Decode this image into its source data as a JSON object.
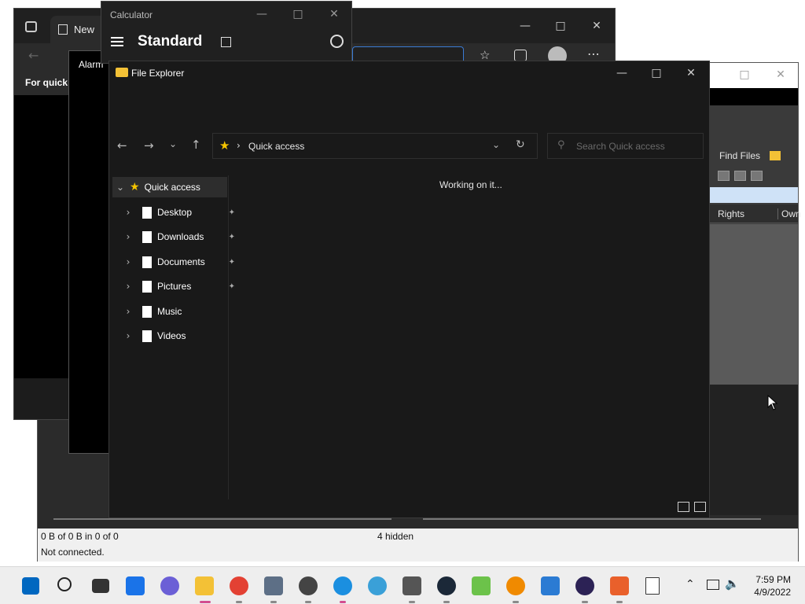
{
  "filezilla": {
    "find_files": "Find Files",
    "col_rights": "Rights",
    "col_owner": "Own",
    "status_left": "0 B of 0 B in 0 of 0",
    "status_hidden": "4 hidden",
    "status_conn": "Not connected."
  },
  "edge": {
    "tab_title": "New",
    "info_text": "For quick a"
  },
  "alarms": {
    "title": "Alarm"
  },
  "calculator": {
    "title": "Calculator",
    "mode": "Standard"
  },
  "explorer": {
    "title": "File Explorer",
    "address": "Quick access",
    "search_placeholder": "Search Quick access",
    "working": "Working on it...",
    "sidebar": [
      {
        "label": "Quick access"
      },
      {
        "label": "Desktop",
        "pinned": true
      },
      {
        "label": "Downloads",
        "pinned": true
      },
      {
        "label": "Documents",
        "pinned": true
      },
      {
        "label": "Pictures",
        "pinned": true
      },
      {
        "label": "Music",
        "pinned": false
      },
      {
        "label": "Videos",
        "pinned": false
      }
    ]
  },
  "taskbar": {
    "time": "7:59 PM",
    "date": "4/9/2022",
    "apps": [
      "start-icon",
      "search-icon",
      "task-view-icon",
      "widgets-icon",
      "teams-chat-icon",
      "file-explorer-icon",
      "chrome-icon",
      "calculator-icon",
      "alarms-clock-icon",
      "edge-icon",
      "globe-icon",
      "vpn-lock-icon",
      "steam-icon",
      "android-app-icon",
      "search-tool-icon",
      "vscode-icon",
      "eclipse-icon",
      "settings-app-icon",
      "notepad-icon"
    ]
  },
  "colors": {
    "accent": "#0067c0",
    "folder": "#f3c136",
    "star": "#f5c400"
  }
}
